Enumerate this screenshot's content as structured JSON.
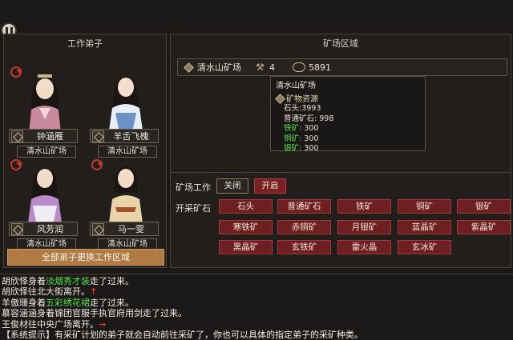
{
  "left_panel": {
    "title": "工作弟子",
    "disciples": [
      {
        "name": "钟涵雁",
        "location": "清水山矿场"
      },
      {
        "name": "羊舌飞槐",
        "location": "清水山矿场"
      },
      {
        "name": "风芳润",
        "location": "清水山矿场"
      },
      {
        "name": "马一雯",
        "location": "清水山矿场"
      }
    ],
    "change_all_label": "全部弟子更换工作区域"
  },
  "right_panel": {
    "title": "矿场区域",
    "mine_bar": {
      "name": "清水山矿场",
      "worker_count": "4",
      "coins": "5891"
    },
    "tooltip": {
      "title": "清水山矿场",
      "resources_label": "矿物资源",
      "rows": [
        {
          "label": "石头:",
          "value": "3993",
          "green": false
        },
        {
          "label": "普通矿石:",
          "value": "998",
          "green": false
        },
        {
          "label": "铁矿:",
          "value": "300",
          "green": true
        },
        {
          "label": "铜矿:",
          "value": "300",
          "green": true
        },
        {
          "label": "银矿:",
          "value": "300",
          "green": true
        }
      ]
    },
    "work_label": "矿场工作",
    "off_label": "关闭",
    "on_label": "开启",
    "mining_label": "开采矿石",
    "ores": [
      "石头",
      "普通矿石",
      "铁矿",
      "铜矿",
      "银矿",
      "寒铁矿",
      "赤铜矿",
      "月银矿",
      "蓝晶矿",
      "紫晶矿",
      "黑晶矿",
      "玄铁矿",
      "雷火晶",
      "玄冰矿"
    ]
  },
  "log": {
    "line1": {
      "pre": "胡欣怿身着",
      "item": "淡烟秀才装",
      "post": "走了过来。"
    },
    "line2": {
      "text": "胡欣怿往北大街离开。",
      "arrow": "↑"
    },
    "line3": {
      "pre": "羊傲珊身着",
      "item": "五彩绣花裙",
      "post": "走了过来。"
    },
    "line4": {
      "text": "慕容涵涵身着锦团官服手执官府用剑走了过来。"
    },
    "line5": {
      "text": "王俊材往中央广场离开。",
      "arrow": "→"
    },
    "line6": {
      "text": "【系统提示】有采矿计划的弟子就会自动前往采矿了，你也可以具体的指定弟子的采矿种类。"
    }
  }
}
